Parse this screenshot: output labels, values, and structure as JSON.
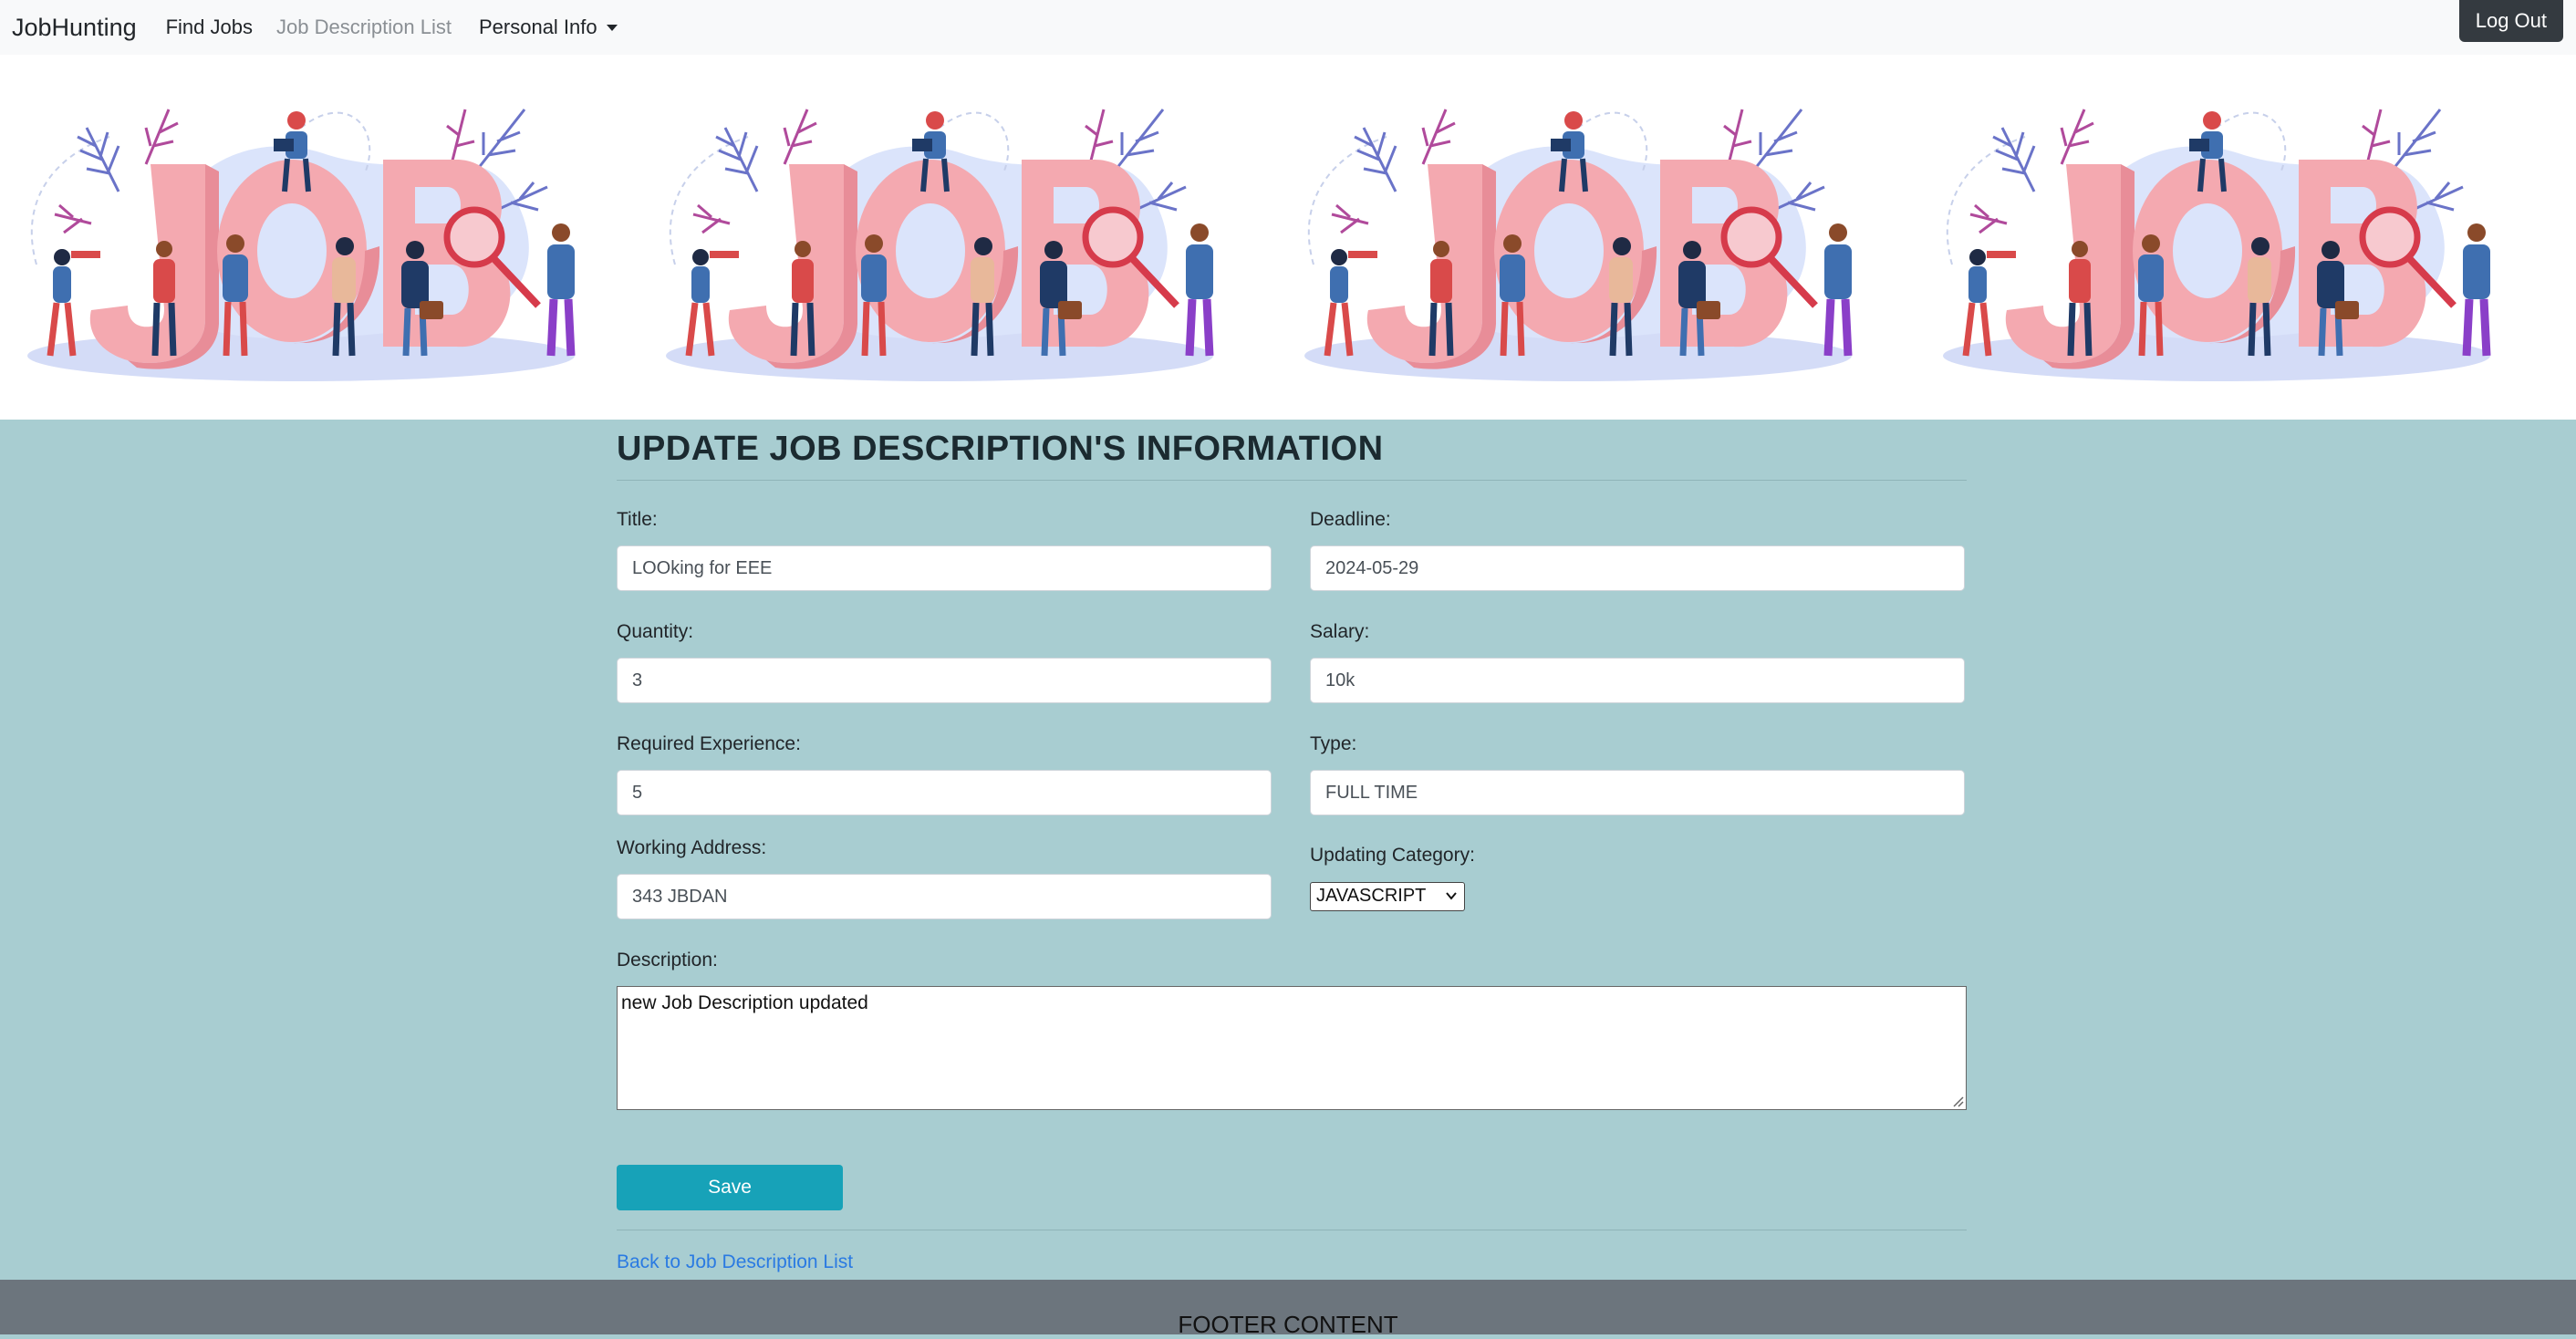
{
  "navbar": {
    "brand": "JobHunting",
    "links": [
      "Find Jobs",
      "Job Description List"
    ],
    "dropdown_label": "Personal Info",
    "logout_label": "Log Out"
  },
  "banner": {
    "illustration_word": "JOB"
  },
  "form": {
    "title": "UPDATE JOB DESCRIPTION'S INFORMATION",
    "title_label": "Title:",
    "title_value": "LOOking for EEE",
    "deadline_label": "Deadline:",
    "deadline_value": "2024-05-29",
    "quantity_label": "Quantity:",
    "quantity_value": "3",
    "salary_label": "Salary:",
    "salary_value": "10k",
    "experience_label": "Required Experience:",
    "experience_value": "5",
    "type_label": "Type:",
    "type_value": "FULL TIME",
    "address_label": "Working Address:",
    "address_value": "343 JBDAN",
    "category_label": "Updating Category:",
    "category_value": "JAVASCRIPT",
    "description_label": "Description:",
    "description_value": "new Job Description updated",
    "save_label": "Save",
    "back_link": "Back to Job Description List"
  },
  "footer": {
    "text": "FOOTER CONTENT"
  },
  "colors": {
    "page_bg": "#a8cdd1",
    "navbar_bg": "#f8f9fa",
    "save_button": "#17a2b8",
    "footer_bg": "#6c757d",
    "logout_bg": "#343a40",
    "link": "#2a7ae2"
  }
}
